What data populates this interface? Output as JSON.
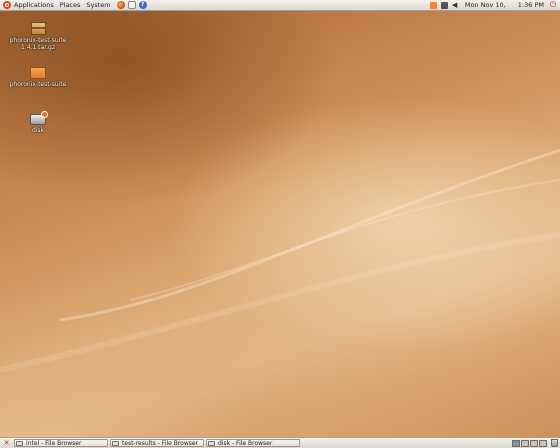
{
  "top_panel": {
    "menus": [
      "Applications",
      "Places",
      "System"
    ],
    "launchers": [
      "firefox-icon",
      "mail-icon",
      "help-icon"
    ],
    "tray_icons": [
      "update-notifier-icon",
      "network-icon",
      "volume-icon"
    ],
    "clock": {
      "date": "Mon Nov 10,",
      "time": "1:36 PM"
    },
    "power_icon": "power-icon"
  },
  "desktop": {
    "icons": [
      {
        "label": "phoronix-test-suite\n1.4.1.tar.gz",
        "icon": "package-icon"
      },
      {
        "label": "phoronix-test-suite",
        "icon": "folder-icon"
      },
      {
        "label": "disk",
        "icon": "disk-icon"
      }
    ]
  },
  "bottom_panel": {
    "tasks": [
      {
        "label": "intel - File Browser"
      },
      {
        "label": "test-results - File Browser"
      },
      {
        "label": "disk - File Browser"
      }
    ],
    "workspaces": 4,
    "active_workspace": 1
  },
  "colors": {
    "wallpaper_dark": "#a2622f",
    "wallpaper_light": "#e6bb8e",
    "panel": "#e6e2dc"
  }
}
